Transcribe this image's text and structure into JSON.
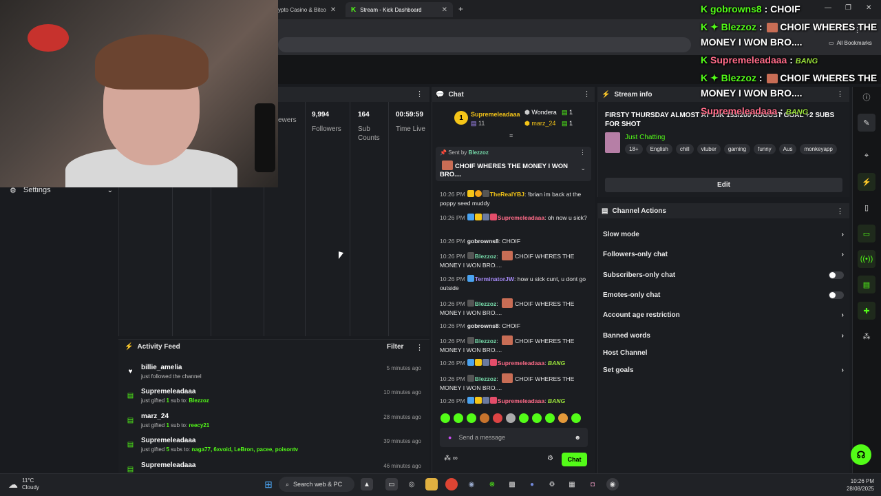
{
  "browser": {
    "tabs": [
      {
        "label": "ypto Casino & Bitco",
        "active": false
      },
      {
        "label": "Stream - Kick Dashboard",
        "active": true
      }
    ],
    "new_tab": "+",
    "bookmarks_label": "All Bookmarks"
  },
  "nav": {
    "settings_label": "Settings"
  },
  "stats": {
    "items": [
      {
        "value": "",
        "label": "ewers"
      },
      {
        "value": "9,994",
        "label": "Followers"
      },
      {
        "value": "164",
        "label": "Sub Counts"
      },
      {
        "value": "00:59:59",
        "label": "Time Live"
      }
    ]
  },
  "activity_feed": {
    "title": "Activity Feed",
    "filter_label": "Filter",
    "items": [
      {
        "name": "billie_amelia",
        "action": "just followed the channel",
        "time": "5 minutes ago",
        "icon": "heart-icon"
      },
      {
        "name": "Supremeleadaaa",
        "action_pre": "just gifted ",
        "count": "1",
        "action_mid": " sub to: ",
        "targets": "Blezzoz",
        "time": "10 minutes ago",
        "icon": "gift-icon"
      },
      {
        "name": "marz_24",
        "action_pre": "just gifted ",
        "count": "1",
        "action_mid": " sub to: ",
        "targets": "reecy21",
        "time": "28 minutes ago",
        "icon": "gift-icon"
      },
      {
        "name": "Supremeleadaaa",
        "action_pre": "just gifted ",
        "count": "5",
        "action_mid": " subs to: ",
        "targets": "naga77, 6xvoid, LeBron, pacee, poisontv",
        "time": "39 minutes ago",
        "icon": "gift-icon"
      },
      {
        "name": "Supremeleadaaa",
        "time": "46 minutes ago",
        "icon": "gift-icon"
      }
    ]
  },
  "chat": {
    "title": "Chat",
    "leaderboard": {
      "first": {
        "rank": "1",
        "name": "Supremeleadaaa",
        "count": "11"
      },
      "second": {
        "name": "Wondera",
        "count": "1"
      },
      "third": {
        "name": "marz_24",
        "count": "1"
      }
    },
    "pinned": {
      "sent_by_label": "Sent by",
      "sender": "Blezzoz",
      "text": "CHOIF WHERES THE MONEY I WON BRO...."
    },
    "messages": [
      {
        "time": "10:26 PM",
        "user": "TheRealYBJ",
        "color": "#f5c518",
        "text": "!brian im back at the poppy seed muddy"
      },
      {
        "time": "10:26 PM",
        "user": "Supremeleadaaa",
        "color": "#ff6b88",
        "text": "oh now u sick?"
      },
      {
        "time": "10:26 PM",
        "user": "gobrowns8",
        "color": "#e8e8e8",
        "text": "CHOIF"
      },
      {
        "time": "10:26 PM",
        "user": "Blezzoz",
        "color": "#75d8a8",
        "text": "CHOIF WHERES THE MONEY I WON BRO...."
      },
      {
        "time": "10:26 PM",
        "user": "TerminatorJW",
        "color": "#a78bfa",
        "text": "how u sick cunt, u dont go outside"
      },
      {
        "time": "10:26 PM",
        "user": "Blezzoz",
        "color": "#75d8a8",
        "text": "CHOIF WHERES THE MONEY I WON BRO...."
      },
      {
        "time": "10:26 PM",
        "user": "gobrowns8",
        "color": "#e8e8e8",
        "text": "CHOIF"
      },
      {
        "time": "10:26 PM",
        "user": "Blezzoz",
        "color": "#75d8a8",
        "text": "CHOIF WHERES THE MONEY I WON BRO...."
      },
      {
        "time": "10:26 PM",
        "user": "Supremeleadaaa",
        "color": "#ff6b88",
        "text": "BANG"
      },
      {
        "time": "10:26 PM",
        "user": "Blezzoz",
        "color": "#75d8a8",
        "text": "CHOIF WHERES THE MONEY I WON BRO...."
      },
      {
        "time": "10:26 PM",
        "user": "Supremeleadaaa",
        "color": "#ff6b88",
        "text": "BANG"
      }
    ],
    "input_placeholder": "Send a message",
    "send_label": "Chat"
  },
  "stream_info": {
    "title": "Stream info",
    "stream_title": "FIRSTY THURSDAY ALMOST AT 10K 153/200 AUGUST GOAL +2 SUBS FOR SHOT",
    "category": "Just Chatting",
    "tags": [
      "18+",
      "English",
      "chill",
      "vtuber",
      "gaming",
      "funny",
      "Aus",
      "monkeyapp"
    ],
    "edit_label": "Edit"
  },
  "channel_actions": {
    "title": "Channel Actions",
    "rows": [
      {
        "label": "Slow mode",
        "control": "chevron"
      },
      {
        "label": "Followers-only chat",
        "control": "chevron"
      },
      {
        "label": "Subscribers-only chat",
        "control": "toggle"
      },
      {
        "label": "Emotes-only chat",
        "control": "toggle"
      },
      {
        "label": "Account age restriction",
        "control": "chevron"
      },
      {
        "label": "Banned words",
        "control": "chevron"
      },
      {
        "label": "Host Channel",
        "control": "none"
      },
      {
        "label": "Set goals",
        "control": "chevron"
      }
    ]
  },
  "overlay_chat": [
    {
      "user": "gobrowns8",
      "text": "CHOIF"
    },
    {
      "user": "Blezzoz",
      "text": "CHOIF WHERES THE"
    },
    {
      "cont": "MONEY I WON BRO...."
    },
    {
      "user": "Supremeleadaaa",
      "text": "BANG"
    },
    {
      "user": "Blezzoz",
      "text": "CHOIF WHERES THE"
    },
    {
      "cont": "MONEY I WON BRO...."
    },
    {
      "user": "Supremeleadaaa",
      "text": "BANG"
    }
  ],
  "taskbar": {
    "weather_temp": "11°C",
    "weather_desc": "Cloudy",
    "search_label": "Search web & PC",
    "time": "10:26 PM",
    "date": "28/08/2025"
  },
  "colors": {
    "kick_green": "#53fc18",
    "panel": "#1b1d21",
    "background": "#191b1f"
  }
}
